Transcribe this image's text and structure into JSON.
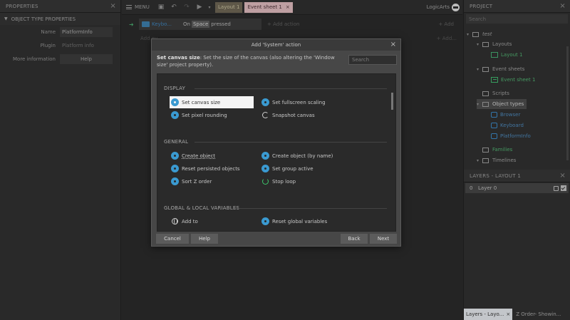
{
  "properties": {
    "title": "PROPERTIES",
    "section": "OBJECT TYPE PROPERTIES",
    "rows": [
      {
        "label": "Name",
        "value": "PlatformInfo"
      },
      {
        "label": "Plugin",
        "value": "Platform info"
      },
      {
        "label": "More information",
        "value": "Help"
      }
    ]
  },
  "topbar": {
    "menu_label": "MENU",
    "tabs": [
      {
        "label": "Layout 1"
      },
      {
        "label": "Event sheet 1",
        "close": "×"
      }
    ],
    "brand": "LogicArts"
  },
  "event_sheet": {
    "object": "Keybo...",
    "condition_prefix": "On",
    "key": "Space",
    "condition_suffix": "pressed",
    "add_action": "+ Add action",
    "add_right": "+ Add",
    "sub_left": "Add ev...",
    "sub_right": "+ Add..."
  },
  "project": {
    "title": "PROJECT",
    "search_placeholder": "Search",
    "tree": [
      {
        "label": "test",
        "kind": "root"
      },
      {
        "label": "Layouts",
        "kind": "folder"
      },
      {
        "label": "Layout 1",
        "kind": "layout"
      },
      {
        "label": "Event sheets",
        "kind": "folder"
      },
      {
        "label": "Event sheet 1",
        "kind": "sheet"
      },
      {
        "label": "Scripts",
        "kind": "folder"
      },
      {
        "label": "Object types",
        "kind": "folder"
      },
      {
        "label": "Browser",
        "kind": "object"
      },
      {
        "label": "Keyboard",
        "kind": "object"
      },
      {
        "label": "PlatformInfo",
        "kind": "object"
      },
      {
        "label": "Families",
        "kind": "folder"
      },
      {
        "label": "Timelines",
        "kind": "folder"
      }
    ]
  },
  "layers": {
    "title": "LAYERS - LAYOUT 1",
    "rows": [
      {
        "index": "0",
        "name": "Layer 0"
      }
    ]
  },
  "bottom_tabs": [
    {
      "label": "Layers - Layo...",
      "close": "×"
    },
    {
      "label": "Z Order- Showin..."
    }
  ],
  "dialog": {
    "title": "Add 'System' action",
    "desc_bold": "Set canvas size",
    "desc_rest": ": Set the size of the canvas (also altering the 'Window size' project property).",
    "search_placeholder": "Search",
    "categories": [
      {
        "name": "DISPLAY",
        "actions": [
          {
            "label": "Set canvas size",
            "icon": "gear-icon"
          },
          {
            "label": "Set fullscreen scaling",
            "icon": "gear-icon"
          },
          {
            "label": "Set pixel rounding",
            "icon": "gear-icon"
          },
          {
            "label": "Snapshot canvas",
            "icon": "snapshot-icon"
          }
        ]
      },
      {
        "name": "GENERAL",
        "actions": [
          {
            "label": "Create object",
            "icon": "gear-icon"
          },
          {
            "label": "Create object (by name)",
            "icon": "gear-icon"
          },
          {
            "label": "Reset persisted objects",
            "icon": "gear-icon"
          },
          {
            "label": "Set group active",
            "icon": "gear-icon"
          },
          {
            "label": "Sort Z order",
            "icon": "gear-icon"
          },
          {
            "label": "Stop loop",
            "icon": "loop-icon"
          }
        ]
      },
      {
        "name": "GLOBAL & LOCAL VARIABLES",
        "actions": [
          {
            "label": "Add to",
            "icon": "globe-icon"
          },
          {
            "label": "Reset global variables",
            "icon": "gear-icon"
          }
        ]
      }
    ],
    "buttons": {
      "cancel": "Cancel",
      "help": "Help",
      "back": "Back",
      "next": "Next"
    }
  }
}
